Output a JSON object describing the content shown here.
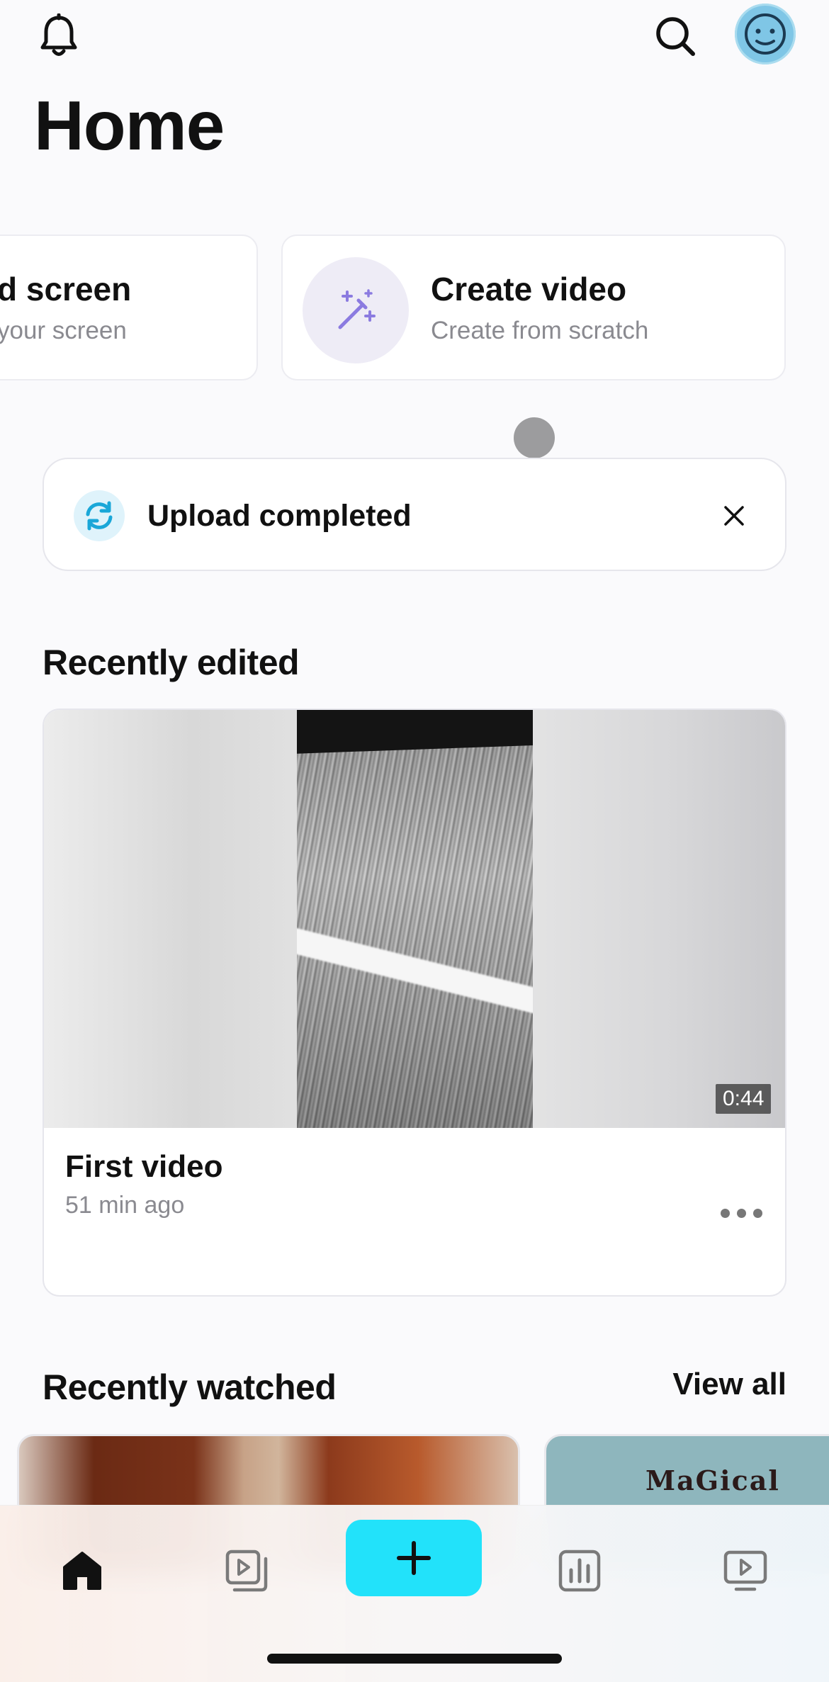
{
  "header": {
    "title": "Home",
    "icons": [
      "bell-icon",
      "search-icon",
      "avatar"
    ]
  },
  "actions": {
    "record": {
      "title": "d screen",
      "subtitle": "your screen"
    },
    "create": {
      "title": "Create video",
      "subtitle": "Create from scratch",
      "icon": "magic-wand-icon"
    }
  },
  "toast": {
    "message": "Upload completed",
    "icon": "sync-icon",
    "close_icon": "close-icon"
  },
  "recently_edited": {
    "heading": "Recently edited",
    "video": {
      "title": "First video",
      "time": "51 min ago",
      "duration": "0:44"
    }
  },
  "recently_watched": {
    "heading": "Recently watched",
    "view_all": "View all",
    "thumb_2_text": "MaGical"
  },
  "bottom_nav": {
    "items": [
      "home-icon",
      "library-icon",
      "add-icon",
      "analytics-icon",
      "watch-icon"
    ],
    "accent": "#22e2fa"
  },
  "colors": {
    "accent": "#22e2fa",
    "avatar": "#7fc6e6",
    "wand": "#8b7be0"
  }
}
